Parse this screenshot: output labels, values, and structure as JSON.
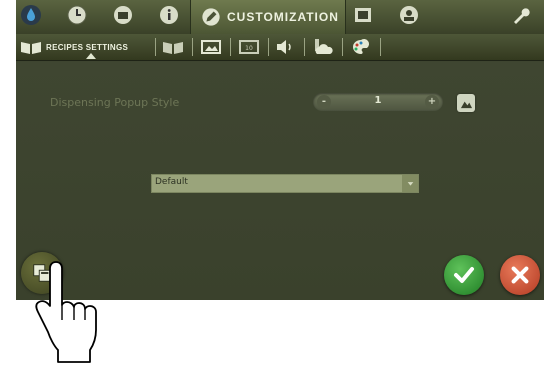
{
  "top_tabs": {
    "items": [
      {
        "icon": "water-drop-icon"
      },
      {
        "icon": "clock-icon"
      },
      {
        "icon": "cleaning-icon"
      },
      {
        "icon": "info-icon"
      },
      {
        "icon": "pencil-icon",
        "label": "CUSTOMIZATION",
        "active": true
      },
      {
        "icon": "server-icon"
      },
      {
        "icon": "user-profile-icon"
      },
      {
        "icon": "wrench-icon"
      }
    ]
  },
  "sub_tabs": {
    "items": [
      {
        "icon": "book-icon",
        "label": "RECIPES SETTINGS",
        "active": true
      },
      {
        "icon": "open-book-icon"
      },
      {
        "icon": "picture-icon"
      },
      {
        "icon": "screen-icon"
      },
      {
        "icon": "speaker-icon"
      },
      {
        "icon": "cloud-icon"
      },
      {
        "icon": "palette-icon"
      }
    ]
  },
  "dispensing": {
    "label": "Dispensing Popup Style",
    "minus": "-",
    "value": "1",
    "plus": "+"
  },
  "style_select": {
    "selected": "Default"
  },
  "colors": {
    "background": "#3e4530",
    "select": "#9aa47b",
    "confirm": "#2e9b2e",
    "cancel": "#d04a2e"
  }
}
